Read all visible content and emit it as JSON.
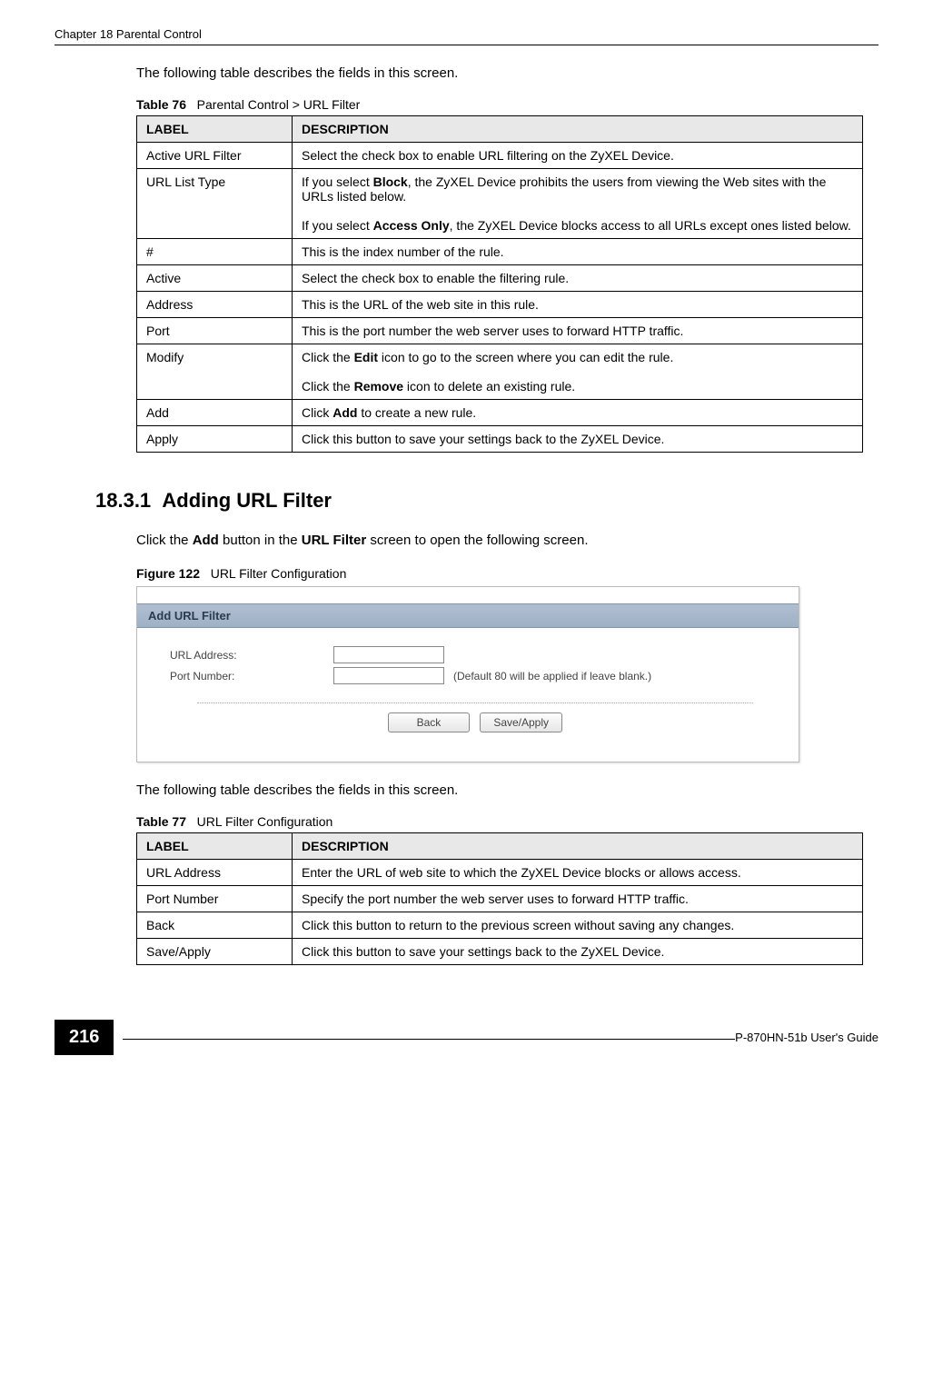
{
  "header": {
    "chapter": "Chapter 18 Parental Control"
  },
  "intro1": "The following table describes the fields in this screen.",
  "table76": {
    "caption_num": "Table 76",
    "caption_text": "Parental Control > URL Filter",
    "col_label": "LABEL",
    "col_desc": "DESCRIPTION",
    "rows": [
      {
        "label": "Active URL Filter",
        "desc": "Select the check box to enable URL filtering on the ZyXEL Device."
      },
      {
        "label": "URL List Type",
        "desc_parts": [
          {
            "pre": "If you select ",
            "bold": "Block",
            "post": ", the ZyXEL Device prohibits the users from viewing the Web sites with the URLs listed below."
          },
          {
            "pre": "If you select ",
            "bold": "Access Only",
            "post": ", the ZyXEL Device blocks access to all URLs except ones listed below."
          }
        ]
      },
      {
        "label": "#",
        "desc": "This is the index number of the rule."
      },
      {
        "label": "Active",
        "desc": "Select the check box to enable the filtering rule."
      },
      {
        "label": "Address",
        "desc": "This is the URL of the web site in this rule."
      },
      {
        "label": "Port",
        "desc": "This is the port number the web server uses to forward HTTP traffic."
      },
      {
        "label": "Modify",
        "desc_parts": [
          {
            "pre": "Click the ",
            "bold": "Edit",
            "post": " icon to go to the screen where you can edit the rule."
          },
          {
            "pre": "Click the ",
            "bold": "Remove",
            "post": " icon to delete an existing rule."
          }
        ]
      },
      {
        "label": "Add",
        "desc_parts": [
          {
            "pre": "Click ",
            "bold": "Add",
            "post": " to create a new rule."
          }
        ]
      },
      {
        "label": "Apply",
        "desc": "Click this button to save your settings back to the ZyXEL Device."
      }
    ]
  },
  "section": {
    "number": "18.3.1",
    "title": "Adding URL Filter",
    "text_parts": {
      "pre": "Click the ",
      "bold1": "Add",
      "mid": " button in the ",
      "bold2": "URL Filter",
      "post": " screen to open the following screen."
    }
  },
  "figure": {
    "num": "Figure 122",
    "title": "URL Filter Configuration",
    "banner": "Add URL Filter",
    "url_label": "URL Address:",
    "port_label": "Port Number:",
    "hint": "(Default 80 will be applied if leave blank.)",
    "back_btn": "Back",
    "save_btn": "Save/Apply"
  },
  "intro2": "The following table describes the fields in this screen.",
  "table77": {
    "caption_num": "Table 77",
    "caption_text": "URL Filter Configuration",
    "col_label": "LABEL",
    "col_desc": "DESCRIPTION",
    "rows": [
      {
        "label": "URL Address",
        "desc": "Enter the URL of web site to which the ZyXEL Device blocks or allows access."
      },
      {
        "label": "Port Number",
        "desc": "Specify the port number the web server uses to forward HTTP traffic."
      },
      {
        "label": "Back",
        "desc": "Click this button to return to the previous screen without saving any changes."
      },
      {
        "label": "Save/Apply",
        "desc": "Click this button to save your settings back to the ZyXEL Device."
      }
    ]
  },
  "footer": {
    "page": "216",
    "guide": "P-870HN-51b User's Guide"
  }
}
